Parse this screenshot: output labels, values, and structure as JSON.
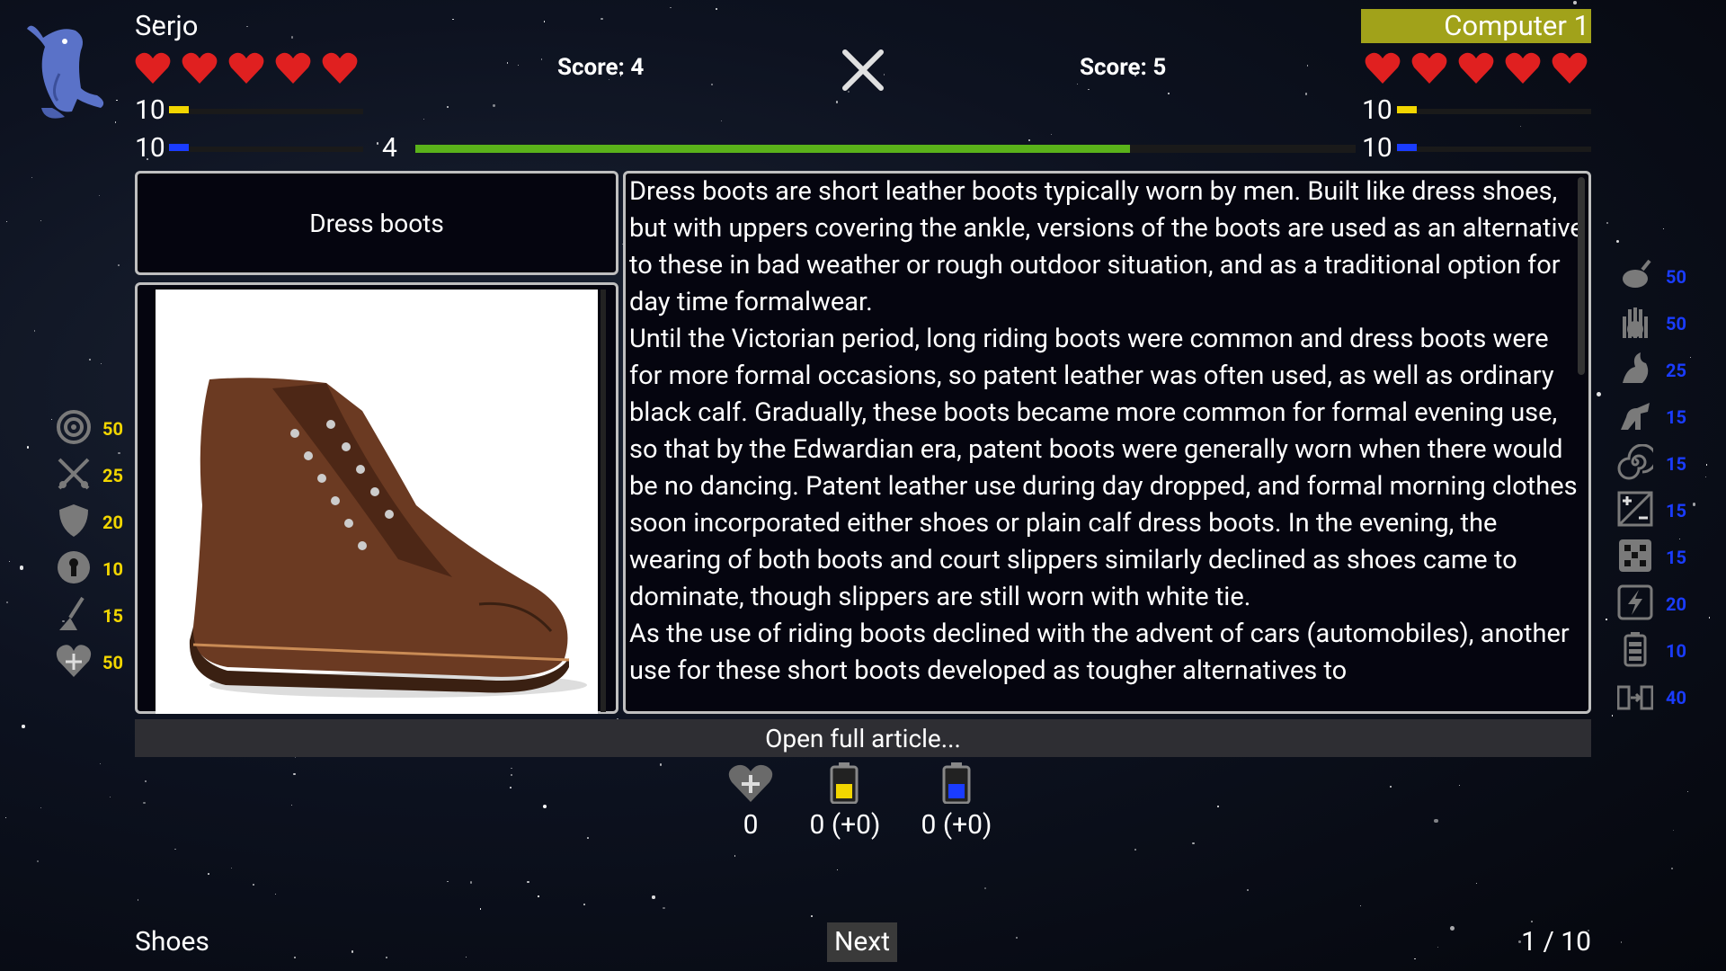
{
  "player": {
    "name": "Serjo",
    "score_label": "Score: 4",
    "hearts": 5,
    "yellow_value": "10",
    "blue_value": "10",
    "colors": {
      "heart": "#e02020",
      "yellow": "#f2d600",
      "blue": "#1a3cff"
    }
  },
  "opponent": {
    "name": "Computer 1",
    "score_label": "Score: 5",
    "hearts": 5,
    "yellow_value": "10",
    "blue_value": "10",
    "name_bg": "#a1a21a"
  },
  "timer": {
    "value": "4",
    "progress": 0.76,
    "color": "#5ab21a"
  },
  "card": {
    "title": "Dress boots",
    "image_icon": "brown-leather-boot",
    "article_paragraphs": [
      "Dress boots are short leather boots typically worn by men. Built like dress shoes, but with uppers covering the ankle, versions of the boots are used as an alternative to these in bad weather or rough outdoor situation, and as a traditional option for day time formalwear.",
      "Until the Victorian period, long riding boots were common and dress boots were for more formal occasions, so patent leather was often used, as well as ordinary black calf. Gradually, these boots became more common for formal evening use, so that by the Edwardian era, patent boots were generally worn when there would be no dancing. Patent leather use during day dropped, and formal morning clothes soon incorporated either shoes or plain calf dress boots. In the evening, the wearing of both boots and court slippers similarly declined as shoes came to dominate, though slippers are still worn with white tie.",
      "As the use of riding boots declined with the advent of cars (automobiles), another use for these short boots developed as tougher alternatives to"
    ],
    "open_article_label": "Open full article..."
  },
  "left_skills": [
    {
      "icon": "target-icon",
      "value": "50"
    },
    {
      "icon": "crossed-swords-icon",
      "value": "25"
    },
    {
      "icon": "shield-icon",
      "value": "20"
    },
    {
      "icon": "keyhole-icon",
      "value": "10"
    },
    {
      "icon": "broom-icon",
      "value": "15"
    },
    {
      "icon": "heart-plus-icon",
      "value": "50"
    }
  ],
  "right_skills": [
    {
      "icon": "grenade-icon",
      "value": "50"
    },
    {
      "icon": "hamsa-hand-icon",
      "value": "50"
    },
    {
      "icon": "dragon-icon",
      "value": "25"
    },
    {
      "icon": "dinosaur-icon",
      "value": "15"
    },
    {
      "icon": "spiral-icon",
      "value": "15"
    },
    {
      "icon": "plus-minus-icon",
      "value": "15"
    },
    {
      "icon": "dice-icon",
      "value": "15"
    },
    {
      "icon": "lightning-icon",
      "value": "20"
    },
    {
      "icon": "battery-icon",
      "value": "10"
    },
    {
      "icon": "battery-transfer-icon",
      "value": "40"
    }
  ],
  "resources": [
    {
      "icon": "heart-plus-icon",
      "value": "0"
    },
    {
      "icon": "yellow-battery-icon",
      "value": "0 (+0)"
    },
    {
      "icon": "blue-battery-icon",
      "value": "0 (+0)"
    }
  ],
  "footer": {
    "category": "Shoes",
    "next_label": "Next",
    "page": "1 / 10"
  },
  "colors": {
    "left_skill": "#f2d600",
    "right_skill": "#1a3cff"
  }
}
